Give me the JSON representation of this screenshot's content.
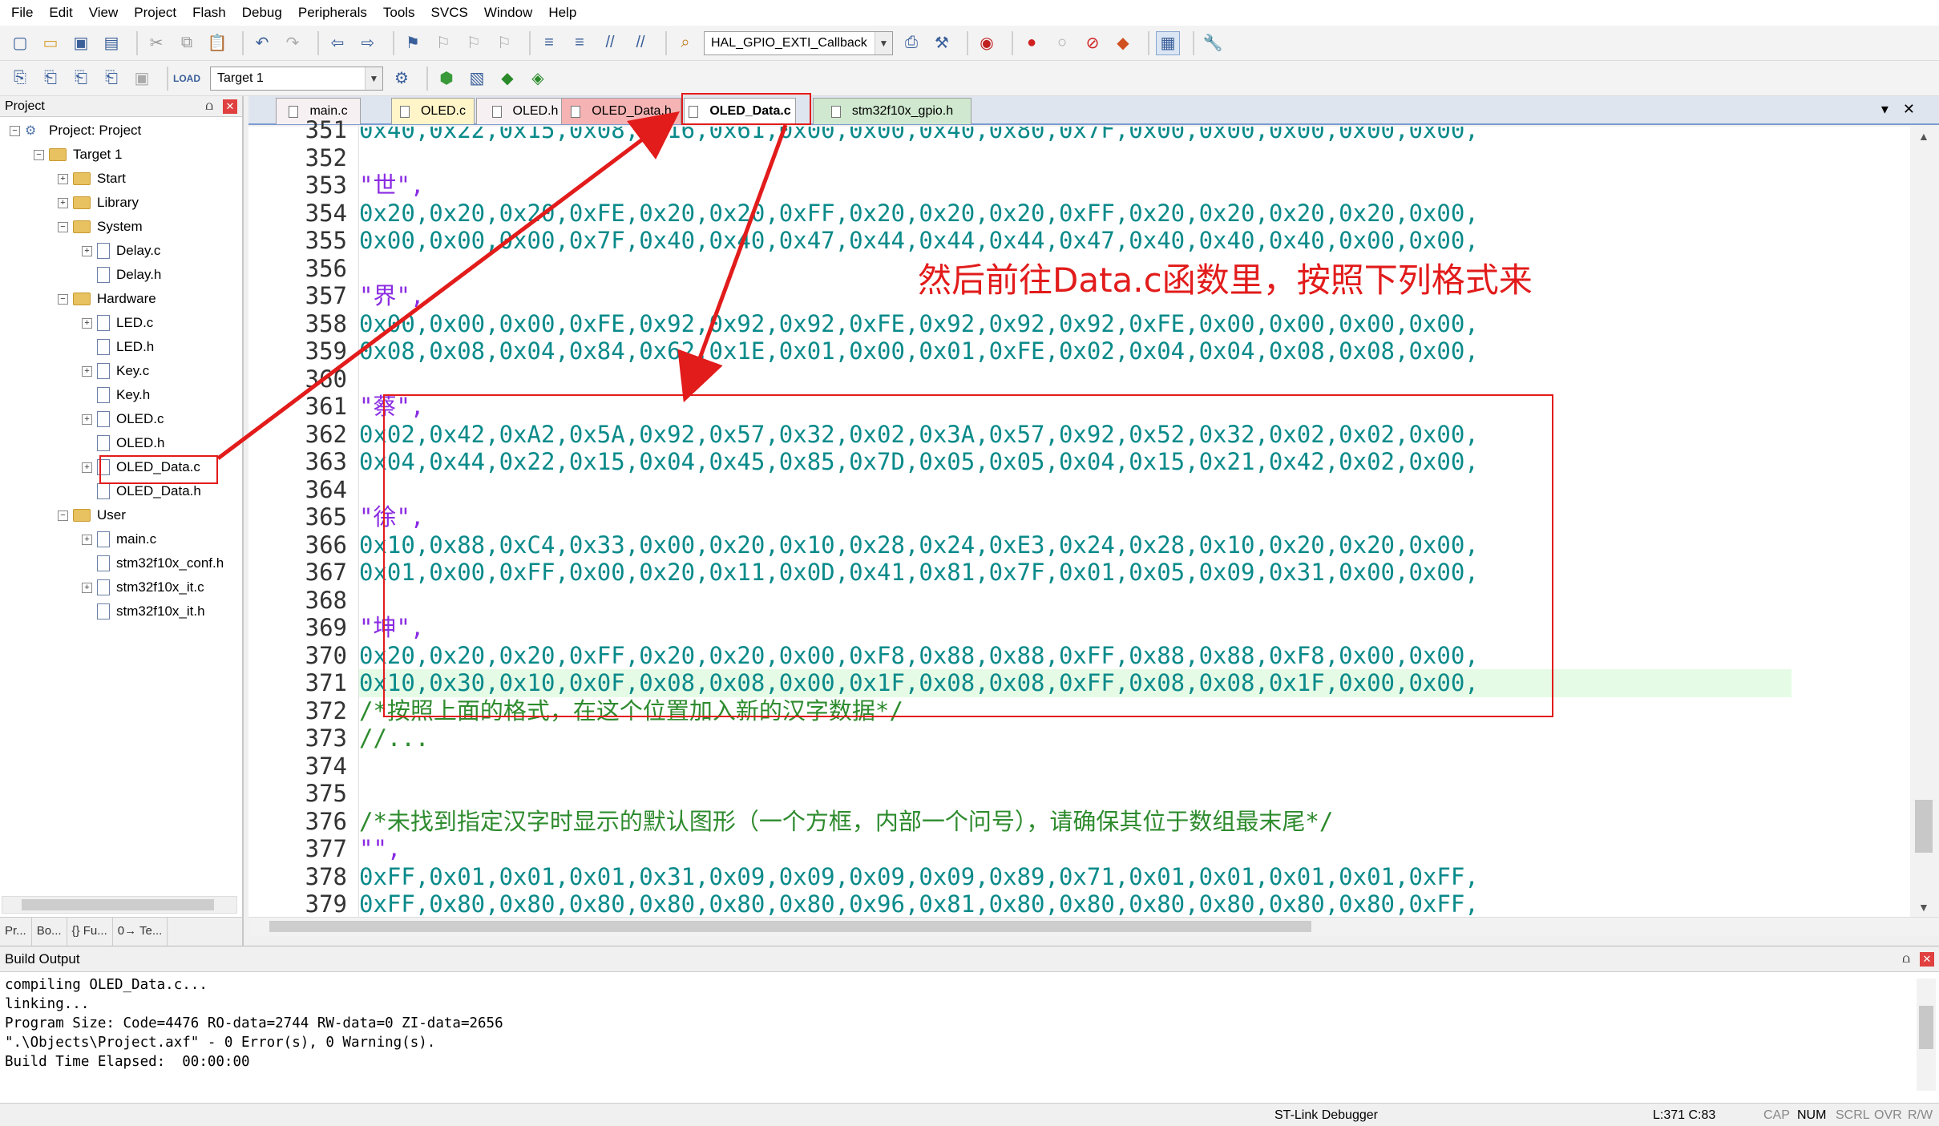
{
  "menu": [
    "File",
    "Edit",
    "View",
    "Project",
    "Flash",
    "Debug",
    "Peripherals",
    "Tools",
    "SVCS",
    "Window",
    "Help"
  ],
  "toolbar": {
    "function_combo": "HAL_GPIO_EXTI_Callback",
    "target_combo": "Target 1"
  },
  "project_panel": {
    "title": "Project",
    "pin": "⩍",
    "close": "✕",
    "root": "Project: Project",
    "target": "Target 1",
    "groups": {
      "start": "Start",
      "library": "Library",
      "system": "System",
      "hardware": "Hardware",
      "user": "User"
    },
    "files": {
      "delay_c": "Delay.c",
      "delay_h": "Delay.h",
      "led_c": "LED.c",
      "led_h": "LED.h",
      "key_c": "Key.c",
      "key_h": "Key.h",
      "oled_c": "OLED.c",
      "oled_h": "OLED.h",
      "oled_data_c": "OLED_Data.c",
      "oled_data_h": "OLED_Data.h",
      "main_c": "main.c",
      "conf_h": "stm32f10x_conf.h",
      "it_c": "stm32f10x_it.c",
      "it_h": "stm32f10x_it.h"
    },
    "bottom_tabs": [
      "Pr...",
      "Bo...",
      "{} Fu...",
      "0→ Te..."
    ]
  },
  "editor_tabs": [
    "main.c",
    "OLED.c",
    "OLED.h",
    "OLED_Data.h",
    "OLED_Data.c",
    "stm32f10x_gpio.h"
  ],
  "code_lines": [
    {
      "n": "351",
      "t": "0x40,0x22,0x15,0x08,0x16,0x61,0x00,0x00,0x40,0x80,0x7F,0x00,0x00,0x00,0x00,0x00,",
      "k": "hex"
    },
    {
      "n": "352",
      "t": "",
      "k": "hex"
    },
    {
      "n": "353",
      "t": "\"世\",",
      "k": "str"
    },
    {
      "n": "354",
      "t": "0x20,0x20,0x20,0xFE,0x20,0x20,0xFF,0x20,0x20,0x20,0xFF,0x20,0x20,0x20,0x20,0x00,",
      "k": "hex"
    },
    {
      "n": "355",
      "t": "0x00,0x00,0x00,0x7F,0x40,0x40,0x47,0x44,0x44,0x44,0x47,0x40,0x40,0x40,0x00,0x00,",
      "k": "hex"
    },
    {
      "n": "356",
      "t": "",
      "k": "hex"
    },
    {
      "n": "357",
      "t": "\"界\",",
      "k": "str"
    },
    {
      "n": "358",
      "t": "0x00,0x00,0x00,0xFE,0x92,0x92,0x92,0xFE,0x92,0x92,0x92,0xFE,0x00,0x00,0x00,0x00,",
      "k": "hex"
    },
    {
      "n": "359",
      "t": "0x08,0x08,0x04,0x84,0x62,0x1E,0x01,0x00,0x01,0xFE,0x02,0x04,0x04,0x08,0x08,0x00,",
      "k": "hex"
    },
    {
      "n": "360",
      "t": "",
      "k": "hex"
    },
    {
      "n": "361",
      "t": "\"蔡\",",
      "k": "str"
    },
    {
      "n": "362",
      "t": "0x02,0x42,0xA2,0x5A,0x92,0x57,0x32,0x02,0x3A,0x57,0x92,0x52,0x32,0x02,0x02,0x00,",
      "k": "hex"
    },
    {
      "n": "363",
      "t": "0x04,0x44,0x22,0x15,0x04,0x45,0x85,0x7D,0x05,0x05,0x04,0x15,0x21,0x42,0x02,0x00,",
      "k": "hex"
    },
    {
      "n": "364",
      "t": "",
      "k": "hex"
    },
    {
      "n": "365",
      "t": "\"徐\",",
      "k": "str"
    },
    {
      "n": "366",
      "t": "0x10,0x88,0xC4,0x33,0x00,0x20,0x10,0x28,0x24,0xE3,0x24,0x28,0x10,0x20,0x20,0x00,",
      "k": "hex"
    },
    {
      "n": "367",
      "t": "0x01,0x00,0xFF,0x00,0x20,0x11,0x0D,0x41,0x81,0x7F,0x01,0x05,0x09,0x31,0x00,0x00,",
      "k": "hex"
    },
    {
      "n": "368",
      "t": "",
      "k": "hex"
    },
    {
      "n": "369",
      "t": "\"坤\",",
      "k": "str"
    },
    {
      "n": "370",
      "t": "0x20,0x20,0x20,0xFF,0x20,0x20,0x00,0xF8,0x88,0x88,0xFF,0x88,0x88,0xF8,0x00,0x00,",
      "k": "hex"
    },
    {
      "n": "371",
      "t": "0x10,0x30,0x10,0x0F,0x08,0x08,0x00,0x1F,0x08,0x08,0xFF,0x08,0x08,0x1F,0x00,0x00,",
      "k": "hex"
    },
    {
      "n": "372",
      "t": "/*按照上面的格式，在这个位置加入新的汉字数据*/",
      "k": "cmt"
    },
    {
      "n": "373",
      "t": "//...",
      "k": "cmt"
    },
    {
      "n": "374",
      "t": "",
      "k": "hex"
    },
    {
      "n": "375",
      "t": "",
      "k": "hex"
    },
    {
      "n": "376",
      "t": "/*未找到指定汉字时显示的默认图形（一个方框，内部一个问号），请确保其位于数组最末尾*/",
      "k": "cmt"
    },
    {
      "n": "377",
      "t": "\"\",",
      "k": "str"
    },
    {
      "n": "378",
      "t": "0xFF,0x01,0x01,0x01,0x31,0x09,0x09,0x09,0x09,0x89,0x71,0x01,0x01,0x01,0x01,0xFF,",
      "k": "hex"
    },
    {
      "n": "379",
      "t": "0xFF,0x80,0x80,0x80,0x80,0x80,0x80,0x96,0x81,0x80,0x80,0x80,0x80,0x80,0x80,0xFF,",
      "k": "hex"
    }
  ],
  "annotation": "然后前往Data.c函数里，按照下列格式来",
  "annotation_color": "#e21b1b",
  "build_output": {
    "title": "Build Output",
    "lines": [
      "compiling OLED_Data.c...",
      "linking...",
      "Program Size: Code=4476 RO-data=2744 RW-data=0 ZI-data=2656",
      "\".\\Objects\\Project.axf\" - 0 Error(s), 0 Warning(s).",
      "Build Time Elapsed:  00:00:00"
    ]
  },
  "status": {
    "debugger": "ST-Link Debugger",
    "position": "L:371 C:83",
    "caps": "CAP",
    "num": "NUM",
    "scrl": "SCRL",
    "ovr": "OVR",
    "rw": "R/W"
  }
}
